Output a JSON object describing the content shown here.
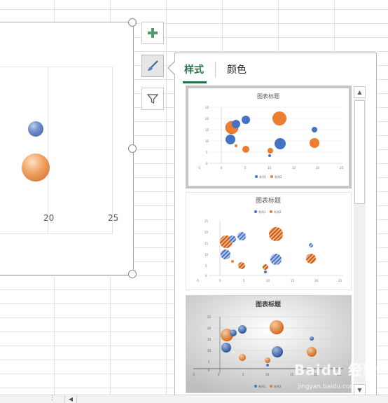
{
  "chart": {
    "x_ticks": [
      "20",
      "25"
    ],
    "bubbles": [
      {
        "series": "blue",
        "x": 16.3,
        "y": 13.8
      },
      {
        "series": "orange",
        "x": 16.3,
        "y": 7.3
      }
    ]
  },
  "side_buttons": [
    {
      "name": "chart-elements-button",
      "icon": "plus-icon"
    },
    {
      "name": "chart-styles-button",
      "icon": "paintbrush-icon"
    },
    {
      "name": "chart-filters-button",
      "icon": "funnel-icon"
    }
  ],
  "panel": {
    "tabs": [
      "样式",
      "颜色"
    ],
    "selected_tab": "样式",
    "thumbnail_title": "图表标题",
    "legend": [
      "系列1",
      "系列2"
    ],
    "y_ticks": [
      "25",
      "20",
      "15",
      "10",
      "5",
      "0"
    ],
    "x_ticks": [
      "-5",
      "0",
      "5",
      "10",
      "15",
      "20",
      "25"
    ]
  },
  "watermark": {
    "text": "Baidu 经验",
    "url": "jingyan.baidu.com"
  },
  "colors": {
    "accent": "#217346",
    "series1": "#4472c4",
    "series2": "#ed7d31"
  }
}
